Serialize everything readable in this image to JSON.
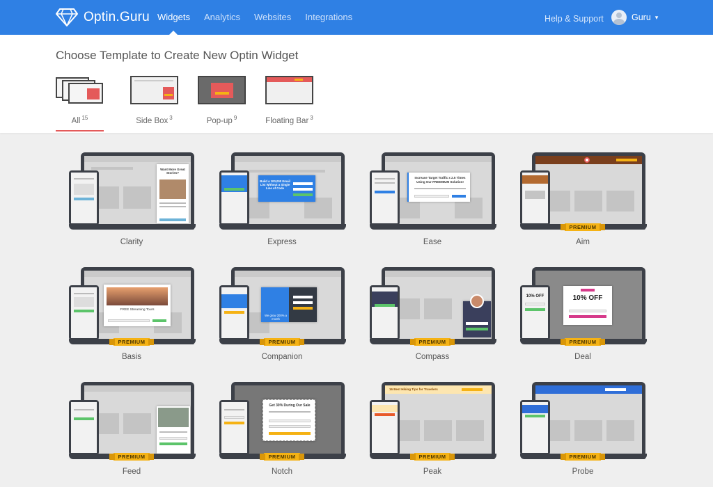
{
  "app": {
    "name": "Optin.Guru"
  },
  "nav": {
    "items": [
      "Widgets",
      "Analytics",
      "Websites",
      "Integrations"
    ],
    "active": "Widgets"
  },
  "help": {
    "label": "Help & Support"
  },
  "user": {
    "name": "Guru"
  },
  "page": {
    "title": "Choose Template to Create New Optin Widget"
  },
  "filters": [
    {
      "label": "All",
      "count": "15",
      "active": true
    },
    {
      "label": "Side Box",
      "count": "3"
    },
    {
      "label": "Pop-up",
      "count": "9"
    },
    {
      "label": "Floating Bar",
      "count": "3"
    }
  ],
  "badge_label": "PREMIUM",
  "templates": [
    {
      "name": "Clarity",
      "premium": false
    },
    {
      "name": "Express",
      "premium": false
    },
    {
      "name": "Ease",
      "premium": false
    },
    {
      "name": "Aim",
      "premium": true
    },
    {
      "name": "Basis",
      "premium": true
    },
    {
      "name": "Companion",
      "premium": true
    },
    {
      "name": "Compass",
      "premium": true
    },
    {
      "name": "Deal",
      "premium": true
    },
    {
      "name": "Feed",
      "premium": true
    },
    {
      "name": "Notch",
      "premium": true
    },
    {
      "name": "Peak",
      "premium": true
    },
    {
      "name": "Probe",
      "premium": true
    }
  ],
  "previews": {
    "clarity": {
      "heading": "Want More Great Stories?"
    },
    "express": {
      "heading": "Build a 100,000 Email List Without a Single Line of Code"
    },
    "ease": {
      "heading": "Increase Target Traffic x 2.5 Times Using Our FREEMIUM Solution!"
    },
    "basis": {
      "heading": "FREE Streaming Tours"
    },
    "companion": {
      "heading": "We grow 200% a month"
    },
    "deal": {
      "heading": "10% OFF"
    },
    "notch": {
      "heading": "Get 30% During Our Sale"
    },
    "peak": {
      "heading": "16 Best Hiking Tips for Travelers"
    }
  },
  "colors": {
    "brand": "#2f80e4",
    "premium": "#f5b214",
    "active_tab": "#e45a5a"
  }
}
